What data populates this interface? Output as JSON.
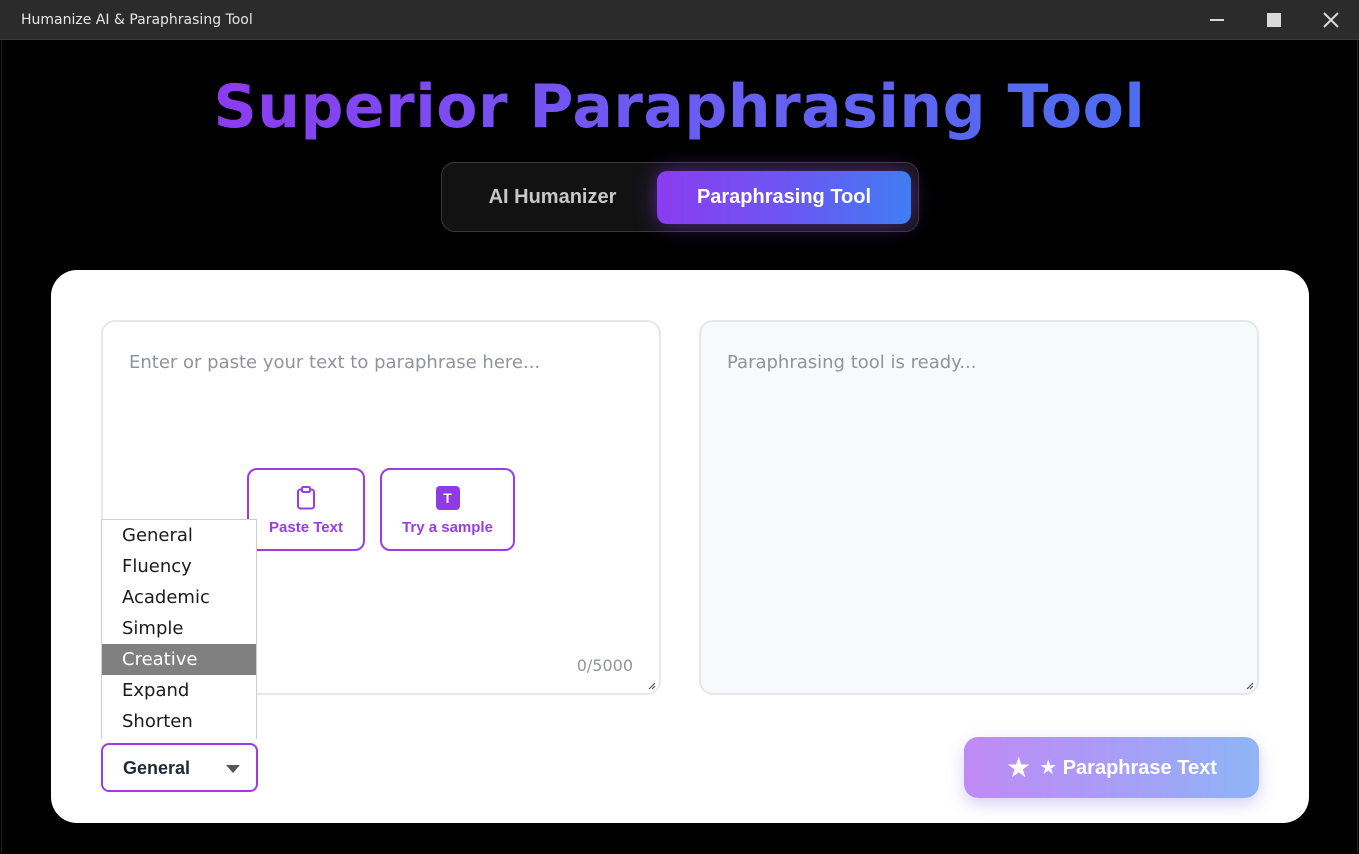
{
  "window": {
    "title": "Humanize AI & Paraphrasing Tool"
  },
  "header": {
    "headline": "Superior Paraphrasing Tool"
  },
  "mode_switch": {
    "tabs": [
      {
        "label": "AI Humanizer",
        "active": false
      },
      {
        "label": "Paraphrasing Tool",
        "active": true
      }
    ]
  },
  "input": {
    "placeholder": "Enter or paste your text to paraphrase here...",
    "counter": "0/5000",
    "paste_label": "Paste Text",
    "sample_label": "Try a sample",
    "sample_badge": "T"
  },
  "output": {
    "placeholder": "Paraphrasing tool is ready..."
  },
  "mode_select": {
    "selected": "General",
    "highlighted": "Creative",
    "options": [
      "General",
      "Fluency",
      "Academic",
      "Simple",
      "Creative",
      "Expand",
      "Shorten"
    ]
  },
  "actions": {
    "paraphrase_star": "★",
    "paraphrase_label": "★ Paraphrase Text"
  },
  "colors": {
    "accent_purple": "#9b3ce8",
    "gradient_start": "#8b3cf0",
    "gradient_end": "#3f7df2"
  }
}
